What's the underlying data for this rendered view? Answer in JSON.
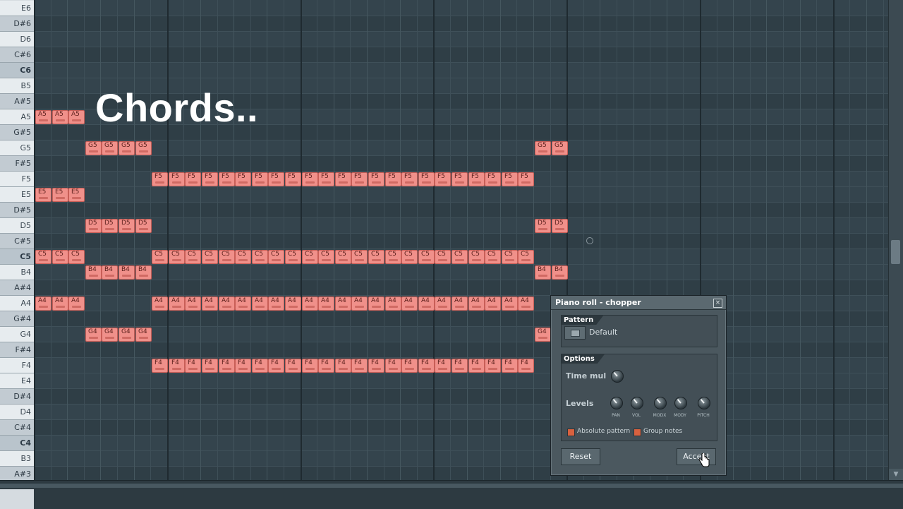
{
  "piano_keys": [
    {
      "label": "E6",
      "type": "white"
    },
    {
      "label": "D#6",
      "type": "black"
    },
    {
      "label": "D6",
      "type": "white"
    },
    {
      "label": "C#6",
      "type": "black"
    },
    {
      "label": "C6",
      "type": "c"
    },
    {
      "label": "B5",
      "type": "white"
    },
    {
      "label": "A#5",
      "type": "black"
    },
    {
      "label": "A5",
      "type": "white"
    },
    {
      "label": "G#5",
      "type": "black"
    },
    {
      "label": "G5",
      "type": "white"
    },
    {
      "label": "F#5",
      "type": "black"
    },
    {
      "label": "F5",
      "type": "white"
    },
    {
      "label": "E5",
      "type": "white"
    },
    {
      "label": "D#5",
      "type": "black"
    },
    {
      "label": "D5",
      "type": "white"
    },
    {
      "label": "C#5",
      "type": "black"
    },
    {
      "label": "C5",
      "type": "c"
    },
    {
      "label": "B4",
      "type": "white"
    },
    {
      "label": "A#4",
      "type": "black"
    },
    {
      "label": "A4",
      "type": "white"
    },
    {
      "label": "G#4",
      "type": "black"
    },
    {
      "label": "G4",
      "type": "white"
    },
    {
      "label": "F#4",
      "type": "black"
    },
    {
      "label": "F4",
      "type": "white"
    },
    {
      "label": "E4",
      "type": "white"
    },
    {
      "label": "D#4",
      "type": "black"
    },
    {
      "label": "D4",
      "type": "white"
    },
    {
      "label": "C#4",
      "type": "black"
    },
    {
      "label": "C4",
      "type": "c"
    },
    {
      "label": "B3",
      "type": "white"
    },
    {
      "label": "A#3",
      "type": "black"
    }
  ],
  "overlay_title": "Chords..",
  "note_runs": [
    {
      "pitch": "A5",
      "start_step": 0,
      "count": 3
    },
    {
      "pitch": "E5",
      "start_step": 0,
      "count": 3
    },
    {
      "pitch": "C5",
      "start_step": 0,
      "count": 3
    },
    {
      "pitch": "A4",
      "start_step": 0,
      "count": 3
    },
    {
      "pitch": "G5",
      "start_step": 3,
      "count": 4
    },
    {
      "pitch": "D5",
      "start_step": 3,
      "count": 4
    },
    {
      "pitch": "B4",
      "start_step": 3,
      "count": 4
    },
    {
      "pitch": "G4",
      "start_step": 3,
      "count": 4
    },
    {
      "pitch": "F5",
      "start_step": 7,
      "count": 23
    },
    {
      "pitch": "C5",
      "start_step": 7,
      "count": 23
    },
    {
      "pitch": "A4",
      "start_step": 7,
      "count": 23
    },
    {
      "pitch": "F4",
      "start_step": 7,
      "count": 23
    },
    {
      "pitch": "G5",
      "start_step": 30,
      "count": 2
    },
    {
      "pitch": "D5",
      "start_step": 30,
      "count": 2
    },
    {
      "pitch": "B4",
      "start_step": 30,
      "count": 2
    },
    {
      "pitch": "G4",
      "start_step": 30,
      "count": 1
    }
  ],
  "dialog": {
    "title": "Piano roll - chopper",
    "close_symbol": "×",
    "pattern_section": "Pattern",
    "pattern_value": "Default",
    "options_section": "Options",
    "time_mul_label": "Time mul",
    "levels_label": "Levels",
    "knobs": [
      "PAN",
      "VOL",
      "MODX",
      "MODY",
      "PITCH"
    ],
    "checkbox_absolute": "Absolute pattern",
    "checkbox_group": "Group notes",
    "reset_button": "Reset",
    "accept_button": "Accept"
  },
  "scroll_down_symbol": "▼",
  "colors": {
    "note_fill": "#f0908a",
    "note_border": "#c85e57",
    "grid": "#34444d",
    "checkbox": "#d8613f"
  }
}
